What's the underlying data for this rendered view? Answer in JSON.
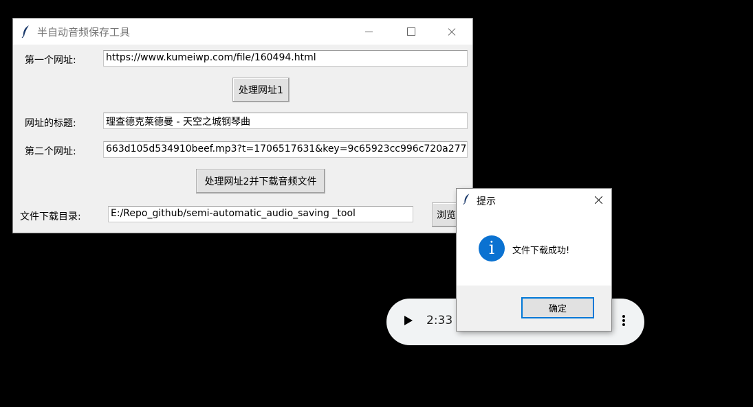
{
  "main_window": {
    "title": "半自动音频保存工具",
    "url1_label": "第一个网址:",
    "url1_value": "https://www.kumeiwp.com/file/160494.html",
    "process1_button": "处理网址1",
    "title_label": "网址的标题:",
    "title_value": "理查德克莱德曼 - 天空之城钢琴曲",
    "url2_label": "第二个网址:",
    "url2_value": "663d105d534910beef.mp3?t=1706517631&key=9c65923cc996c720a277",
    "process2_button": "处理网址2并下载音频文件",
    "dir_label": "文件下载目录:",
    "dir_value": "E:/Repo_github/semi-automatic_audio_saving _tool",
    "browse_button": "浏览"
  },
  "dialog": {
    "title": "提示",
    "message": "文件下载成功!",
    "ok_button": "确定",
    "icon": "info-icon"
  },
  "audio_player": {
    "current_time": "2:33 /"
  },
  "colors": {
    "accent": "#0078d7",
    "info_icon": "#0b72d1",
    "window_bg": "#f0f0f0"
  }
}
